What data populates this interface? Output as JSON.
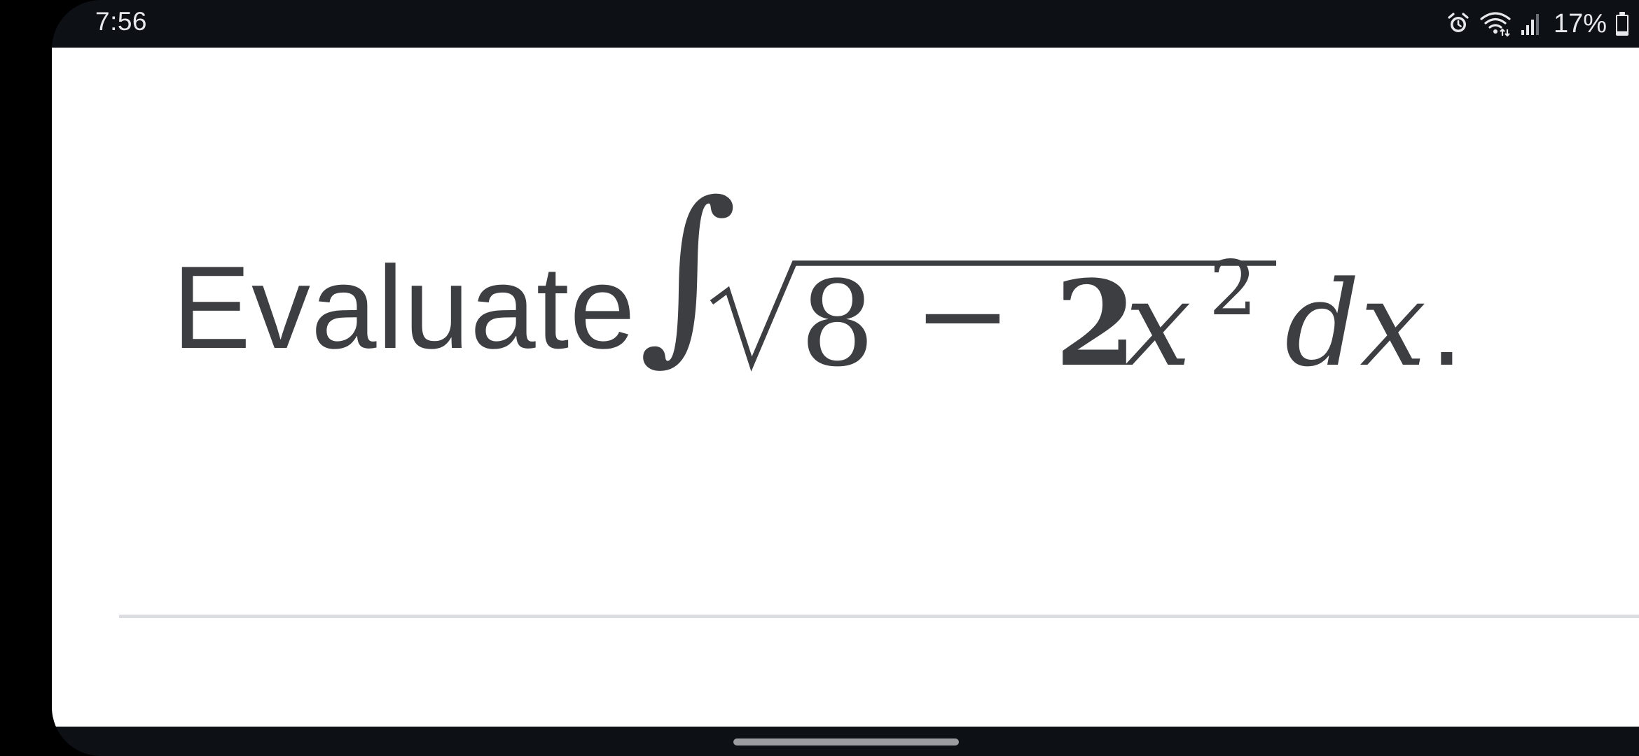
{
  "status_bar": {
    "time": "7:56",
    "battery_percent": "17%",
    "battery_level": 0.17,
    "icons": [
      "alarm-icon",
      "wifi-icon",
      "cell-signal-icon",
      "battery-icon"
    ]
  },
  "question": {
    "prefix": "Evaluate",
    "integral_sign": "∫",
    "radicand_constant": "8",
    "minus": "−",
    "coefficient": "2",
    "variable": "x",
    "exponent": "2",
    "differential": "dx",
    "period": "."
  },
  "colors": {
    "status_bar_bg": "#0d1116",
    "content_bg": "#ffffff",
    "text": "#3d3e42",
    "divider": "#dcdde0"
  }
}
